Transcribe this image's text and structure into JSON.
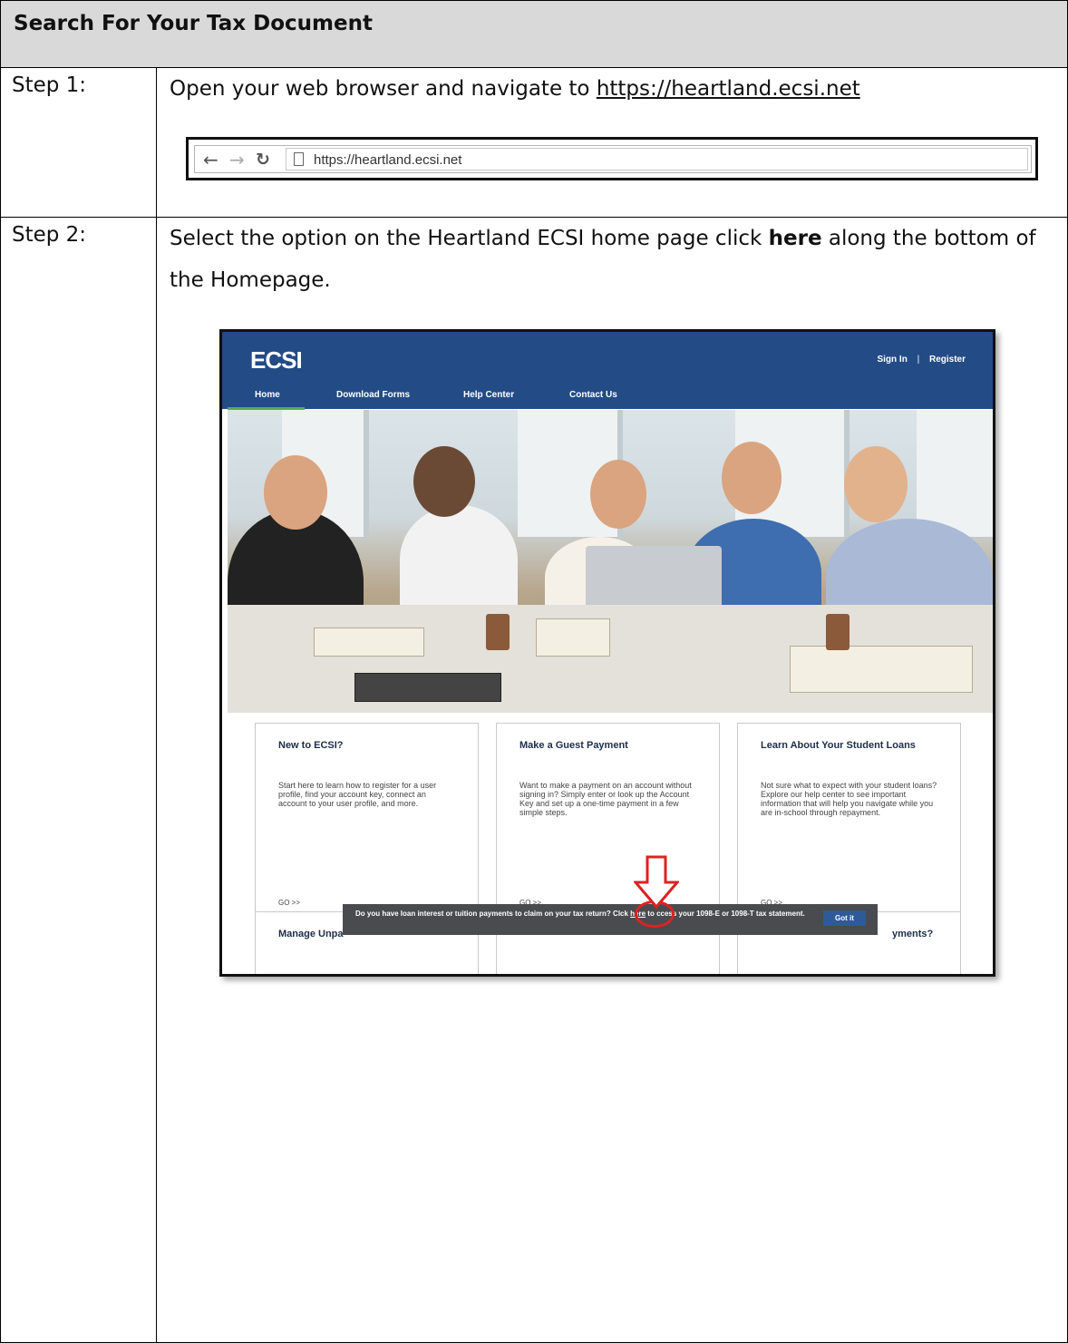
{
  "header": {
    "title": "Search For Your Tax Document"
  },
  "step1": {
    "label": "Step 1:",
    "text_prefix": "Open your web browser and navigate to ",
    "link": "https://heartland.ecsi.net",
    "browser": {
      "url": "https://heartland.ecsi.net"
    }
  },
  "step2": {
    "label": "Step 2:",
    "text_part1": "Select the option on the Heartland ECSI home page click ",
    "text_bold": "here",
    "text_part2": " along the bottom of the Homepage."
  },
  "site": {
    "logo": "ECSI",
    "sign_in": "Sign In",
    "separator": "|",
    "register": "Register",
    "menu": [
      "Home",
      "Download Forms",
      "Help Center",
      "Contact Us"
    ],
    "cards": [
      {
        "title": "New to ECSI?",
        "body": "Start here to learn how to register for a user profile, find your account key, connect an account to your user profile, and more.",
        "go": "GO >>"
      },
      {
        "title": "Make a Guest Payment",
        "body": "Want to make a payment on an account without signing in? Simply enter or look up the Account Key and set up a one-time payment in a few simple steps.",
        "go": "GO >>"
      },
      {
        "title": "Learn About Your Student Loans",
        "body": "Not sure what to expect with your student loans? Explore our help center to see important information that will help you navigate while you are in-school through repayment.",
        "go": "GO >>"
      }
    ],
    "cards_row2": [
      "Manage Unpa",
      "",
      "yments?"
    ],
    "cookie": {
      "text_before": "Do you have loan interest or tuition payments to claim on your tax return? Cl",
      "text_mid": "ck ",
      "link": "here",
      "text_after": " to ",
      "text_after2": "ccess your 1098-E or 1098-T tax statement.",
      "button": "Got it"
    }
  }
}
